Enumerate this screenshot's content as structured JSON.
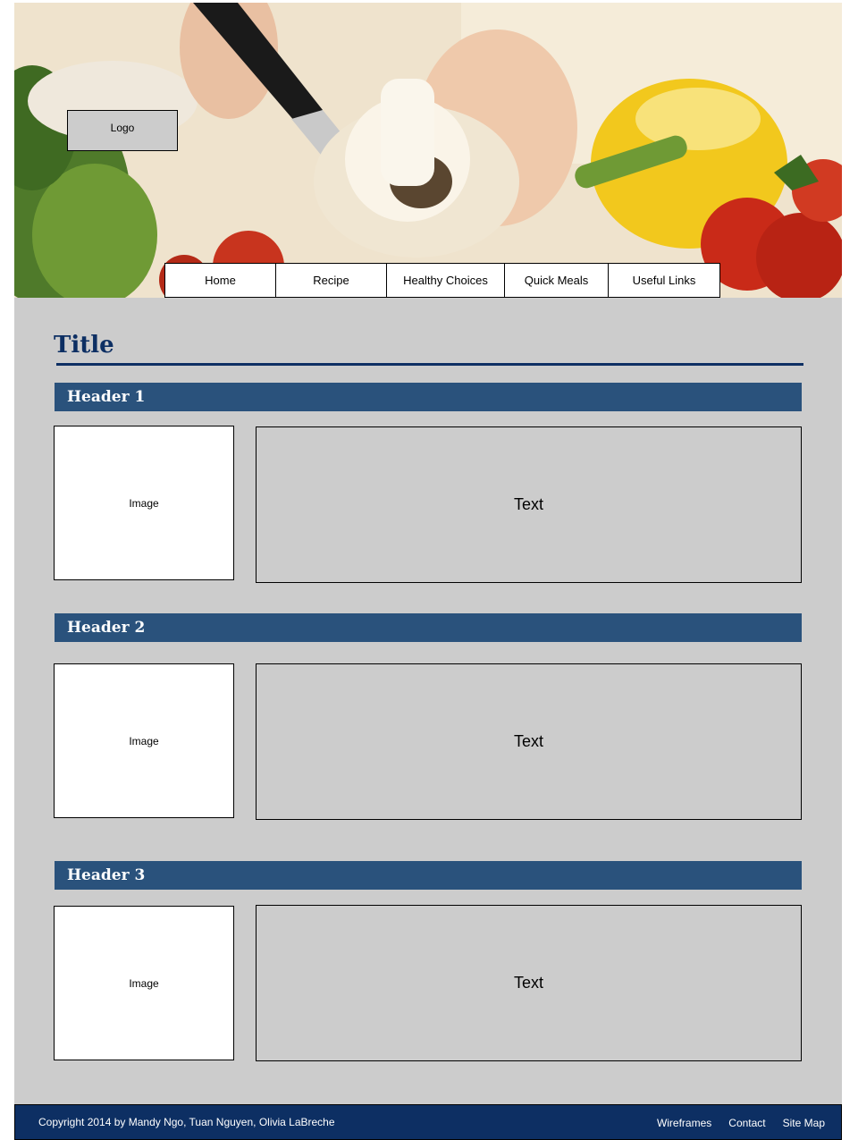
{
  "logo": {
    "label": "Logo"
  },
  "nav": {
    "items": [
      {
        "label": "Home"
      },
      {
        "label": "Recipe"
      },
      {
        "label": "Healthy Choices"
      },
      {
        "label": "Quick Meals"
      },
      {
        "label": "Useful Links"
      }
    ]
  },
  "main": {
    "title": "Title",
    "sections": [
      {
        "header": "Header 1",
        "image_label": "Image",
        "text_label": "Text"
      },
      {
        "header": "Header 2",
        "image_label": "Image",
        "text_label": "Text"
      },
      {
        "header": "Header 3",
        "image_label": "Image",
        "text_label": "Text"
      }
    ]
  },
  "footer": {
    "copyright": "Copyright  2014 by Mandy Ngo, Tuan Nguyen, Olivia LaBreche",
    "links": [
      {
        "label": "Wireframes"
      },
      {
        "label": "Contact"
      },
      {
        "label": "Site Map"
      }
    ]
  },
  "colors": {
    "page_background": "#cccccc",
    "header_bar": "#2a527c",
    "title": "#0d2f63",
    "footer": "#0d2f63"
  }
}
